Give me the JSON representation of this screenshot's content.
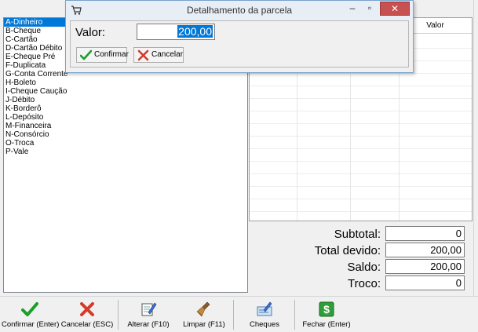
{
  "dialog": {
    "title": "Detalhamento da parcela",
    "minimize": "–",
    "maximize": "▫",
    "close": "✕",
    "valor_label": "Valor:",
    "valor_value": "200,00",
    "confirm_label": "Confirmar",
    "cancel_label": "Cancelar"
  },
  "payment_types": [
    "A-Dinheiro",
    "B-Cheque",
    "C-Cartão",
    "D-Cartão Débito",
    "E-Cheque Pré",
    "F-Duplicata",
    "G-Conta Corrente",
    "H-Boleto",
    "I-Cheque Caução",
    "J-Débito",
    "K-Borderô",
    "L-Depósito",
    "M-Financeira",
    "N-Consórcio",
    "O-Troca",
    "P-Vale"
  ],
  "selected_payment_index": 0,
  "grid": {
    "col_valor": "Valor"
  },
  "totals": {
    "subtotal_label": "Subtotal:",
    "subtotal_value": "0",
    "total_devido_label": "Total devido:",
    "total_devido_value": "200,00",
    "saldo_label": "Saldo:",
    "saldo_value": "200,00",
    "troco_label": "Troco:",
    "troco_value": "0"
  },
  "toolbar": {
    "confirm": "Confirmar (Enter)",
    "cancel": "Cancelar (ESC)",
    "alter": "Alterar (F10)",
    "clear": "Limpar (F11)",
    "cheques": "Cheques",
    "close": "Fechar (Enter)"
  },
  "colors": {
    "selection": "#0078d7",
    "confirm_green": "#1a9e2a",
    "cancel_red": "#d43a2a"
  }
}
